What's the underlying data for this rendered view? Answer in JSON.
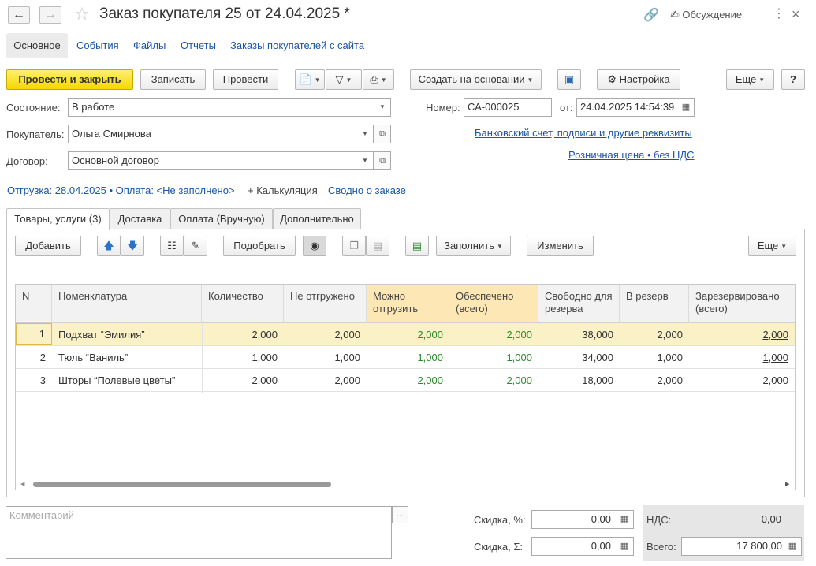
{
  "window": {
    "title": "Заказ покупателя 25 от 24.04.2025 *",
    "discussion_label": "Обсуждение"
  },
  "sections": [
    "Основное",
    "События",
    "Файлы",
    "Отчеты",
    "Заказы покупателей с сайта"
  ],
  "toolbar": {
    "post_close": "Провести и закрыть",
    "save": "Записать",
    "post": "Провести",
    "create_based": "Создать на основании",
    "settings": "Настройка",
    "more": "Еще",
    "help": "?"
  },
  "form": {
    "state_label": "Состояние:",
    "state_value": "В работе",
    "customer_label": "Покупатель:",
    "customer_value": "Ольга Смирнова",
    "contract_label": "Договор:",
    "contract_value": "Основной договор",
    "number_label": "Номер:",
    "number_value": "СА-000025",
    "date_label": "от:",
    "date_value": "24.04.2025 14:54:39",
    "bank_link": "Банковский счет, подписи и другие реквизиты",
    "price_link": "Розничная цена • без НДС",
    "shipping_link": "Отгрузка: 28.04.2025 • Оплата: <Не заполнено>",
    "calc_label": "+ Калькуляция",
    "summary_link": "Сводно о заказе"
  },
  "tabs": [
    "Товары, услуги (3)",
    "Доставка",
    "Оплата (Вручную)",
    "Дополнительно"
  ],
  "table_toolbar": {
    "add": "Добавить",
    "pick": "Подобрать",
    "fill": "Заполнить",
    "change": "Изменить",
    "more": "Еще"
  },
  "table": {
    "headers": [
      "N",
      "Номенклатура",
      "Количество",
      "Не отгружено",
      "Можно отгрузить",
      "Обеспечено (всего)",
      "Свободно для резерва",
      "В резерв",
      "Зарезервировано (всего)"
    ],
    "rows": [
      [
        "1",
        "Подхват “Эмилия”",
        "2,000",
        "2,000",
        "2,000",
        "2,000",
        "38,000",
        "2,000",
        "2,000"
      ],
      [
        "2",
        "Тюль “Ваниль”",
        "1,000",
        "1,000",
        "1,000",
        "1,000",
        "34,000",
        "1,000",
        "1,000"
      ],
      [
        "3",
        "Шторы “Полевые цветы”",
        "2,000",
        "2,000",
        "2,000",
        "2,000",
        "18,000",
        "2,000",
        "2,000"
      ]
    ]
  },
  "footer": {
    "comment_placeholder": "Комментарий",
    "comment_more": "...",
    "discount_pct_label": "Скидка, %:",
    "discount_pct_value": "0,00",
    "discount_sum_label": "Скидка, Σ:",
    "discount_sum_value": "0,00",
    "vat_label": "НДС:",
    "vat_value": "0,00",
    "total_label": "Всего:",
    "total_value": "17 800,00"
  }
}
